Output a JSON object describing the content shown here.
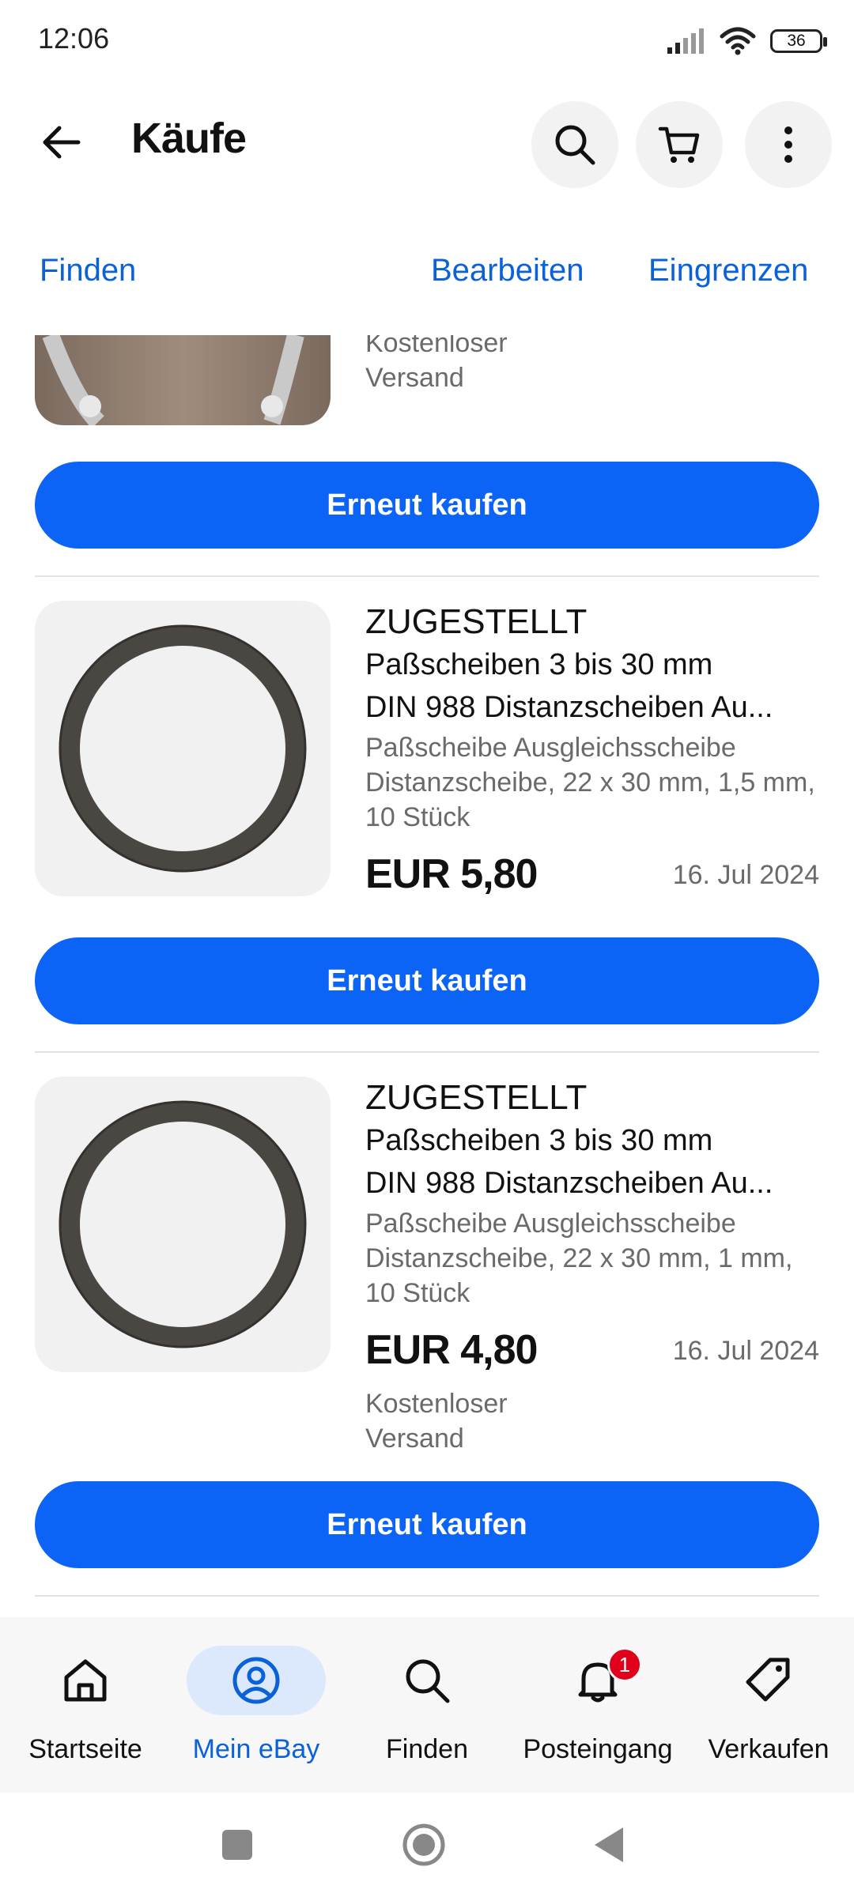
{
  "status_bar": {
    "time": "12:06",
    "battery": "36"
  },
  "app_bar": {
    "title": "Käufe"
  },
  "toolbar": {
    "find": "Finden",
    "edit": "Bearbeiten",
    "filter": "Eingrenzen"
  },
  "orders": [
    {
      "shipping_line1": "Kostenloser",
      "shipping_line2": "Versand",
      "buy_again": "Erneut kaufen"
    },
    {
      "status": "ZUGESTELLT",
      "title_line1": "Paßscheiben 3 bis 30 mm",
      "title_line2": "DIN 988 Distanzscheiben Au...",
      "variant_line1": "Paßscheibe Ausgleichsscheibe",
      "variant_line2": "Distanzscheibe, 22 x 30 mm, 1,5 mm,",
      "variant_line3": "10 Stück",
      "price": "EUR 5,80",
      "date": "16. Jul 2024",
      "buy_again": "Erneut kaufen"
    },
    {
      "status": "ZUGESTELLT",
      "title_line1": "Paßscheiben 3 bis 30 mm",
      "title_line2": "DIN 988 Distanzscheiben Au...",
      "variant_line1": "Paßscheibe Ausgleichsscheibe",
      "variant_line2": "Distanzscheibe, 22 x 30 mm, 1 mm,",
      "variant_line3": "10 Stück",
      "price": "EUR 4,80",
      "date": "16. Jul 2024",
      "shipping_line1": "Kostenloser",
      "shipping_line2": "Versand",
      "buy_again": "Erneut kaufen"
    }
  ],
  "bottom_nav": {
    "items": [
      {
        "label": "Startseite",
        "icon": "home-icon"
      },
      {
        "label": "Mein eBay",
        "icon": "user-circle-icon"
      },
      {
        "label": "Finden",
        "icon": "search-icon"
      },
      {
        "label": "Posteingang",
        "icon": "bell-icon",
        "badge": "1"
      },
      {
        "label": "Verkaufen",
        "icon": "tag-icon"
      }
    ]
  },
  "colors": {
    "accent": "#0b64f5",
    "link": "#0a61d8",
    "active_nav_bg": "#dce8fb",
    "badge": "#e0001b"
  }
}
